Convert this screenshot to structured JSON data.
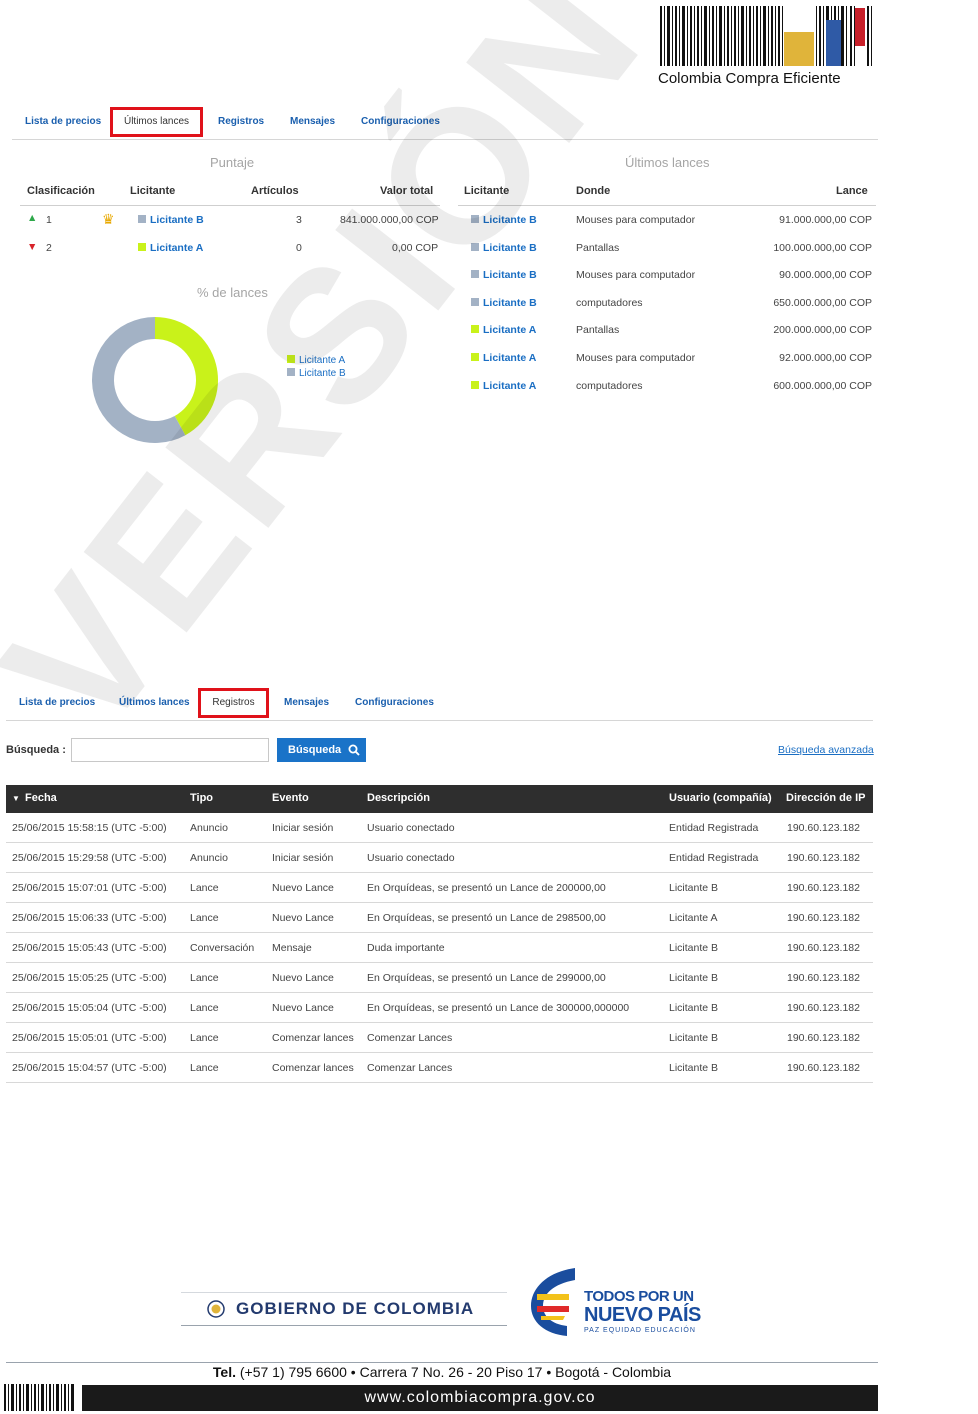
{
  "brand": {
    "logo_text": "Colombia Compra Eficiente"
  },
  "tabs_top": [
    {
      "label": "Lista de precios"
    },
    {
      "label": "Últimos lances"
    },
    {
      "label": "Registros"
    },
    {
      "label": "Mensajes"
    },
    {
      "label": "Configuraciones"
    }
  ],
  "score": {
    "title": "Puntaje",
    "headers": [
      "Clasificación",
      "Licitante",
      "Artículos",
      "Valor total"
    ],
    "rows": [
      {
        "rank": "1",
        "trend": "up",
        "bidder": "Licitante B",
        "color": "#a3b2c5",
        "articles": "3",
        "total": "841.000.000,00 COP"
      },
      {
        "rank": "2",
        "trend": "down",
        "bidder": "Licitante A",
        "color": "#c9f21a",
        "articles": "0",
        "total": "0,00 COP"
      }
    ]
  },
  "donut": {
    "title": "% de lances",
    "legend": [
      {
        "label": "Licitante A",
        "color": "#c9f21a",
        "share": 0.42
      },
      {
        "label": "Licitante B",
        "color": "#a3b2c5",
        "share": 0.58
      }
    ]
  },
  "lances": {
    "title": "Últimos lances",
    "headers": [
      "Licitante",
      "Donde",
      "Lance"
    ],
    "rows": [
      {
        "bidder": "Licitante B",
        "color": "#a3b2c5",
        "where": "Mouses para computador",
        "amount": "91.000.000,00 COP"
      },
      {
        "bidder": "Licitante B",
        "color": "#a3b2c5",
        "where": "Pantallas",
        "amount": "100.000.000,00 COP"
      },
      {
        "bidder": "Licitante B",
        "color": "#a3b2c5",
        "where": "Mouses para computador",
        "amount": "90.000.000,00 COP"
      },
      {
        "bidder": "Licitante B",
        "color": "#a3b2c5",
        "where": "computadores",
        "amount": "650.000.000,00 COP"
      },
      {
        "bidder": "Licitante A",
        "color": "#c9f21a",
        "where": "Pantallas",
        "amount": "200.000.000,00 COP"
      },
      {
        "bidder": "Licitante A",
        "color": "#c9f21a",
        "where": "Mouses para computador",
        "amount": "92.000.000,00 COP"
      },
      {
        "bidder": "Licitante A",
        "color": "#c9f21a",
        "where": "computadores",
        "amount": "600.000.000,00 COP"
      }
    ]
  },
  "search": {
    "label": "Búsqueda :",
    "placeholder": "",
    "button": "Búsqueda",
    "advanced": "Búsqueda avanzada"
  },
  "registros": {
    "headers": [
      "Fecha",
      "Tipo",
      "Evento",
      "Descripción",
      "Usuario (compañía)",
      "Dirección de IP"
    ],
    "rows": [
      [
        "25/06/2015 15:58:15 (UTC -5:00)",
        "Anuncio",
        "Iniciar sesión",
        "Usuario conectado",
        "Entidad Registrada",
        "190.60.123.182"
      ],
      [
        "25/06/2015 15:29:58 (UTC -5:00)",
        "Anuncio",
        "Iniciar sesión",
        "Usuario conectado",
        "Entidad Registrada",
        "190.60.123.182"
      ],
      [
        "25/06/2015 15:07:01 (UTC -5:00)",
        "Lance",
        "Nuevo Lance",
        "En Orquídeas, se presentó un Lance de 200000,00",
        "Licitante B",
        "190.60.123.182"
      ],
      [
        "25/06/2015 15:06:33 (UTC -5:00)",
        "Lance",
        "Nuevo Lance",
        "En Orquídeas, se presentó un Lance de 298500,00",
        "Licitante A",
        "190.60.123.182"
      ],
      [
        "25/06/2015 15:05:43 (UTC -5:00)",
        "Conversación",
        "Mensaje",
        "Duda importante",
        "Licitante B",
        "190.60.123.182"
      ],
      [
        "25/06/2015 15:05:25 (UTC -5:00)",
        "Lance",
        "Nuevo Lance",
        "En Orquídeas, se presentó un Lance de 299000,00",
        "Licitante B",
        "190.60.123.182"
      ],
      [
        "25/06/2015 15:05:04 (UTC -5:00)",
        "Lance",
        "Nuevo Lance",
        "En Orquídeas, se presentó un Lance de 300000,000000",
        "Licitante B",
        "190.60.123.182"
      ],
      [
        "25/06/2015 15:05:01 (UTC -5:00)",
        "Lance",
        "Comenzar lances",
        "Comenzar Lances",
        "Licitante B",
        "190.60.123.182"
      ],
      [
        "25/06/2015 15:04:57 (UTC -5:00)",
        "Lance",
        "Comenzar lances",
        "Comenzar Lances",
        "Licitante B",
        "190.60.123.182"
      ]
    ]
  },
  "footer": {
    "gov": "GOBIERNO DE COLOMBIA",
    "slogan_1": "TODOS POR UN",
    "slogan_2": "NUEVO PAÍS",
    "slogan_3": "PAZ  EQUIDAD  EDUCACIÓN",
    "tel_label": "Tel.",
    "contact": "(+57 1) 795 6600 • Carrera 7 No. 26 - 20 Piso 17 • Bogotá - Colombia",
    "website": "www.colombiacompra.gov.co"
  },
  "watermark": "VERSIÓN PRELIMINAR",
  "colors": {
    "link": "#1a6ec3",
    "tab_highlight": "#e0121a",
    "bidder_a": "#c9f21a",
    "bidder_b": "#a3b2c5",
    "button": "#1a73c8"
  }
}
